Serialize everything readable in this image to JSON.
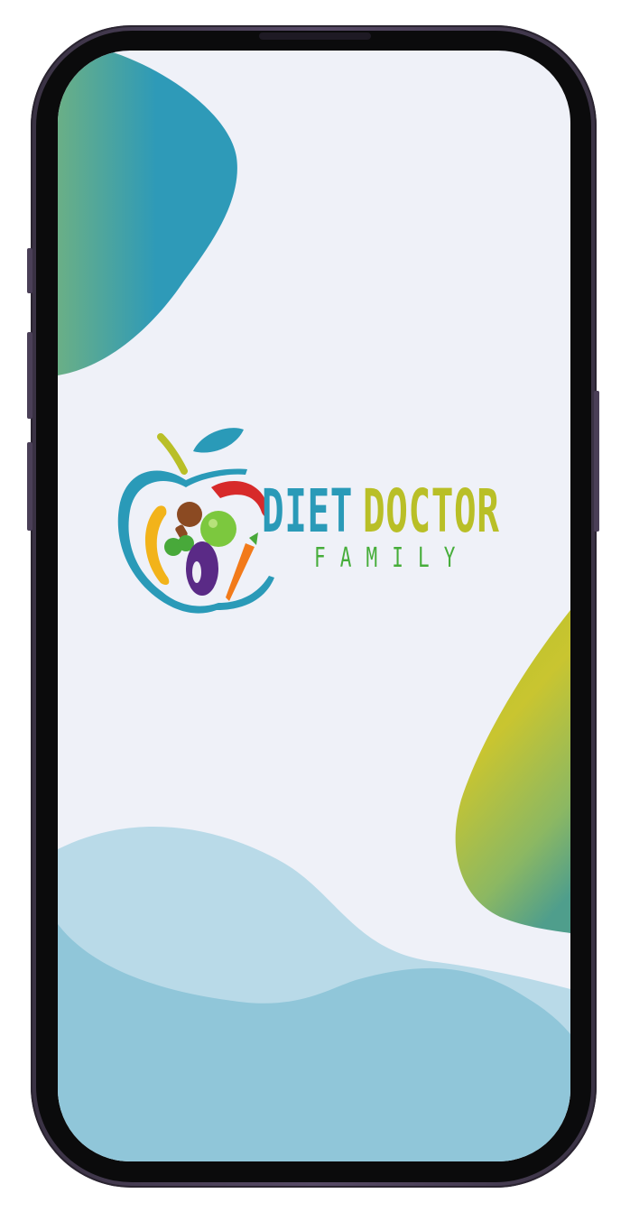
{
  "app": {
    "logo": {
      "word_1": "DIET",
      "word_2": "DOCTOR",
      "word_3": "FAMILY",
      "icon": "apple-fruits-vegetables-icon"
    }
  },
  "colors": {
    "screen_background": "#eff1f8",
    "teal_blob_start": "#6aaf86",
    "teal_blob_end": "#2e9ab8",
    "lime_blob_start": "#c5c52a",
    "lime_blob_end": "#4f9e8c",
    "wave_light": "#b9dae8",
    "wave_dark": "#90c6d9",
    "brand_blue": "#2a9ab8",
    "brand_yellow": "#b9bf27",
    "brand_green": "#46ad3a"
  }
}
